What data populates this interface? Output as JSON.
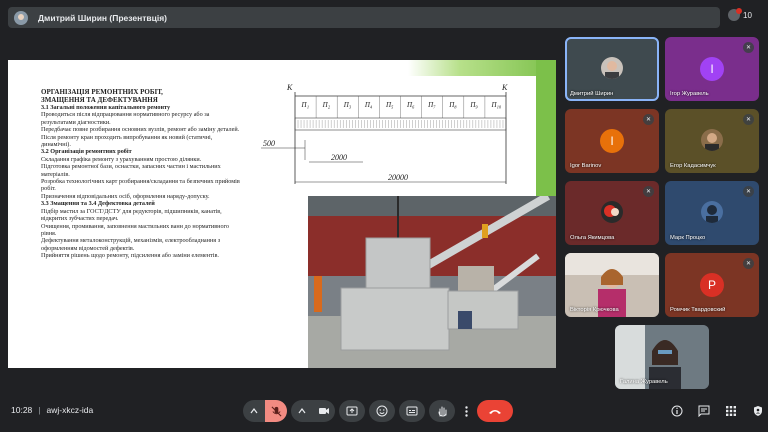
{
  "header": {
    "presenter_title": "Дмитрий Ширин (Презентвція)",
    "participant_count": "10"
  },
  "slide": {
    "title_line1": "ОРГАНІЗАЦІЯ РЕМОНТНИХ РОБІТ,",
    "title_line2": "ЗМАЩЕННЯ ТА ДЕФЕКТУВАННЯ",
    "sec31": "3.1 Загальні положення капітального ремонту",
    "p1": "Проводиться після відпрацювання нормативного ресурсу або за результатами діагностики.",
    "p2": "Передбачає повне розбирання основних вузлів, ремонт або заміну деталей.",
    "p3": "Після ремонту кран проходить випробування як новий (статичні, динамічні).",
    "sec32": "3.2 Організація ремонтних робіт",
    "p4": "Складання графіка ремонту з урахуванням простою ділянки.",
    "p5": "Підготовка ремонтної бази, оснастки, запасних частин і мастильних матеріалів.",
    "p6": "Розробка технологічних карт розбирання/складання та безпечних прийомів робіт.",
    "p7": "Призначення відповідальних осіб, оформлення наряду-допуску.",
    "sec33": "3.3 Змащення та 3.4 Дефектовка деталей",
    "p8": "Підбір мастил за ГОСТ/ДСТУ для редукторів, підшипників, канатів, відкритих зубчастих передач.",
    "p9": "Очищення, промивання, заповнення мастильних ванн до нормативного рівня.",
    "p10": "Дефектування металоконструкцій, механізмів, електрообладнання з оформленням відомостей дефектів.",
    "p11": "Прийняття рішень щодо ремонту, підсилення або заміни елементів.",
    "diagram": {
      "k_left": "K",
      "k_right": "K",
      "p_labels": [
        "П₁",
        "П₂",
        "П₃",
        "П₄",
        "П₅",
        "П₆",
        "П₇",
        "П₈",
        "П₉",
        "П₁₀"
      ],
      "dim_500": "500",
      "dim_2000": "2000",
      "dim_20000": "20000"
    }
  },
  "participants": [
    {
      "name": "Дмитрий Ширин"
    },
    {
      "name": "Ігор Журавель",
      "letter": "I"
    },
    {
      "name": "Igor Barinov",
      "letter": "I"
    },
    {
      "name": "Егор Кадасимчук"
    },
    {
      "name": "Ольга Якимцова"
    },
    {
      "name": "Марк Процко"
    },
    {
      "name": "Вікторія Крючкова"
    },
    {
      "name": "Ромчик Твардовский",
      "letter": "P"
    },
    {
      "name": "Галина Журавель"
    }
  ],
  "footer": {
    "time": "10:28",
    "separator": "|",
    "meeting_code": "awj-xkcz-ida"
  },
  "colors": {
    "background": "#202124",
    "tile_purple": "#a142f4",
    "tile_orange": "#e8710a",
    "tile_red_letter": "#d93025",
    "end_call": "#ea4335",
    "active_outline": "#8ab4f8"
  },
  "icons": [
    "mic-off-icon",
    "camera-icon",
    "present-icon",
    "emoji-icon",
    "captions-icon",
    "raise-hand-icon",
    "more-options-icon",
    "end-call-icon",
    "info-icon",
    "chat-icon",
    "activities-icon",
    "host-controls-icon"
  ]
}
